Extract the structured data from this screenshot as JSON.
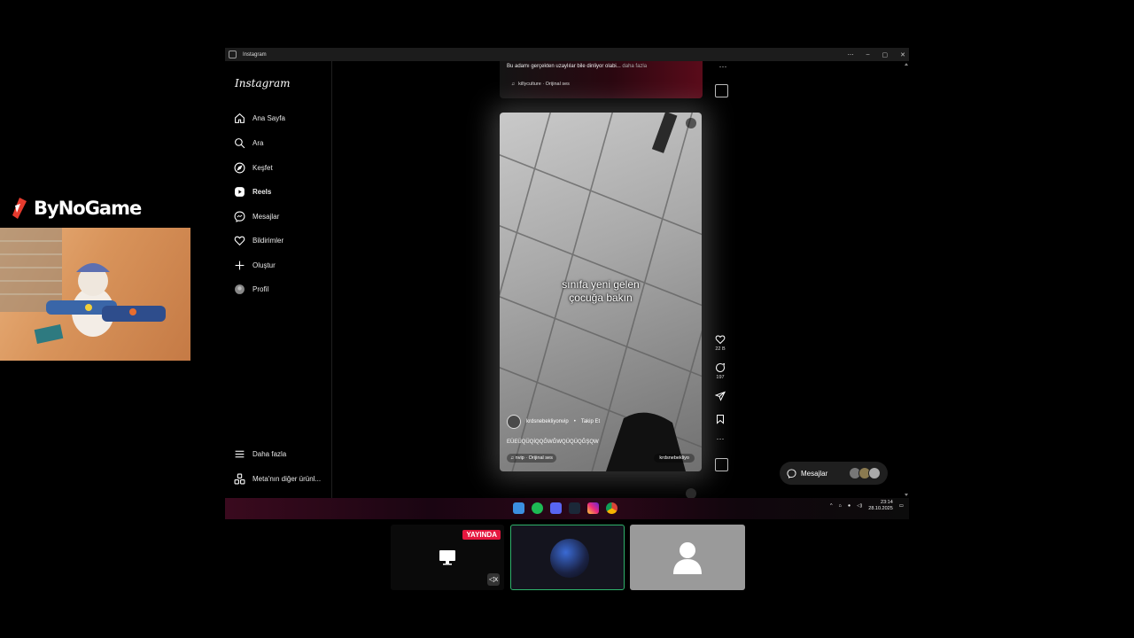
{
  "overlay": {
    "brand": "ByNoGame"
  },
  "window": {
    "title": "Instagram",
    "controls": [
      "⋯",
      "–",
      "▢",
      "✕"
    ]
  },
  "sidebar": {
    "logo": "Instagram",
    "items": [
      {
        "label": "Ana Sayfa",
        "icon": "home-icon"
      },
      {
        "label": "Ara",
        "icon": "search-icon"
      },
      {
        "label": "Keşfet",
        "icon": "compass-icon"
      },
      {
        "label": "Reels",
        "icon": "reels-icon",
        "active": true
      },
      {
        "label": "Mesajlar",
        "icon": "messenger-icon"
      },
      {
        "label": "Bildirimler",
        "icon": "heart-icon"
      },
      {
        "label": "Oluştur",
        "icon": "plus-icon"
      },
      {
        "label": "Profil",
        "icon": "profile-avatar"
      }
    ],
    "more": "Daha fazla",
    "meta": "Meta'nın diğer ürünl..."
  },
  "prev_reel": {
    "caption": "Bu adamı gerçekten uzaylılar bile dinliyor olabi...",
    "more": "daha fazla",
    "audio": "killyculture · Orijinal ses"
  },
  "reel": {
    "overlay_text_1": "sınıfa yeni gelen",
    "overlay_text_2": "çocuğa bakın",
    "username": "krdsnebekliyonvip",
    "dot": "•",
    "follow": "Takip Et",
    "description": "EÜEÜQÜQİQQĞWĞWQÜQÜQĞŞQW",
    "audio": "nvip · Orijinal ses",
    "audio_right": "krdsnebekliyo"
  },
  "actions": {
    "likes": "22 B",
    "comments": "197"
  },
  "messages_pill": {
    "label": "Mesajlar"
  },
  "taskbar": {
    "time": "23:14",
    "date": "28.10.2025"
  },
  "stream": {
    "live_badge": "YAYINDA"
  },
  "colors": {
    "accent_live": "#e5173f",
    "active_border": "#2fb36b",
    "brand_red": "#e63b2e"
  }
}
